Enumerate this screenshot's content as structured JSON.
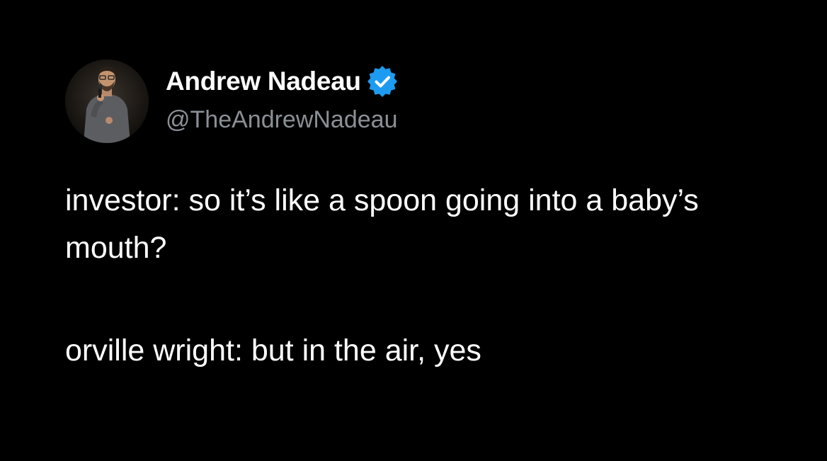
{
  "author": {
    "display_name": "Andrew Nadeau",
    "handle": "@TheAndrewNadeau",
    "verified": true,
    "verified_color": "#1d9bf0",
    "avatar_icon": "profile-photo-person-with-microphone"
  },
  "tweet": {
    "line1": "investor: so it’s like a spoon going into a baby’s mouth?",
    "line2": "orville wright: but in the air, yes"
  },
  "colors": {
    "background": "#000000",
    "text": "#ffffff",
    "handle": "#8b9096"
  }
}
